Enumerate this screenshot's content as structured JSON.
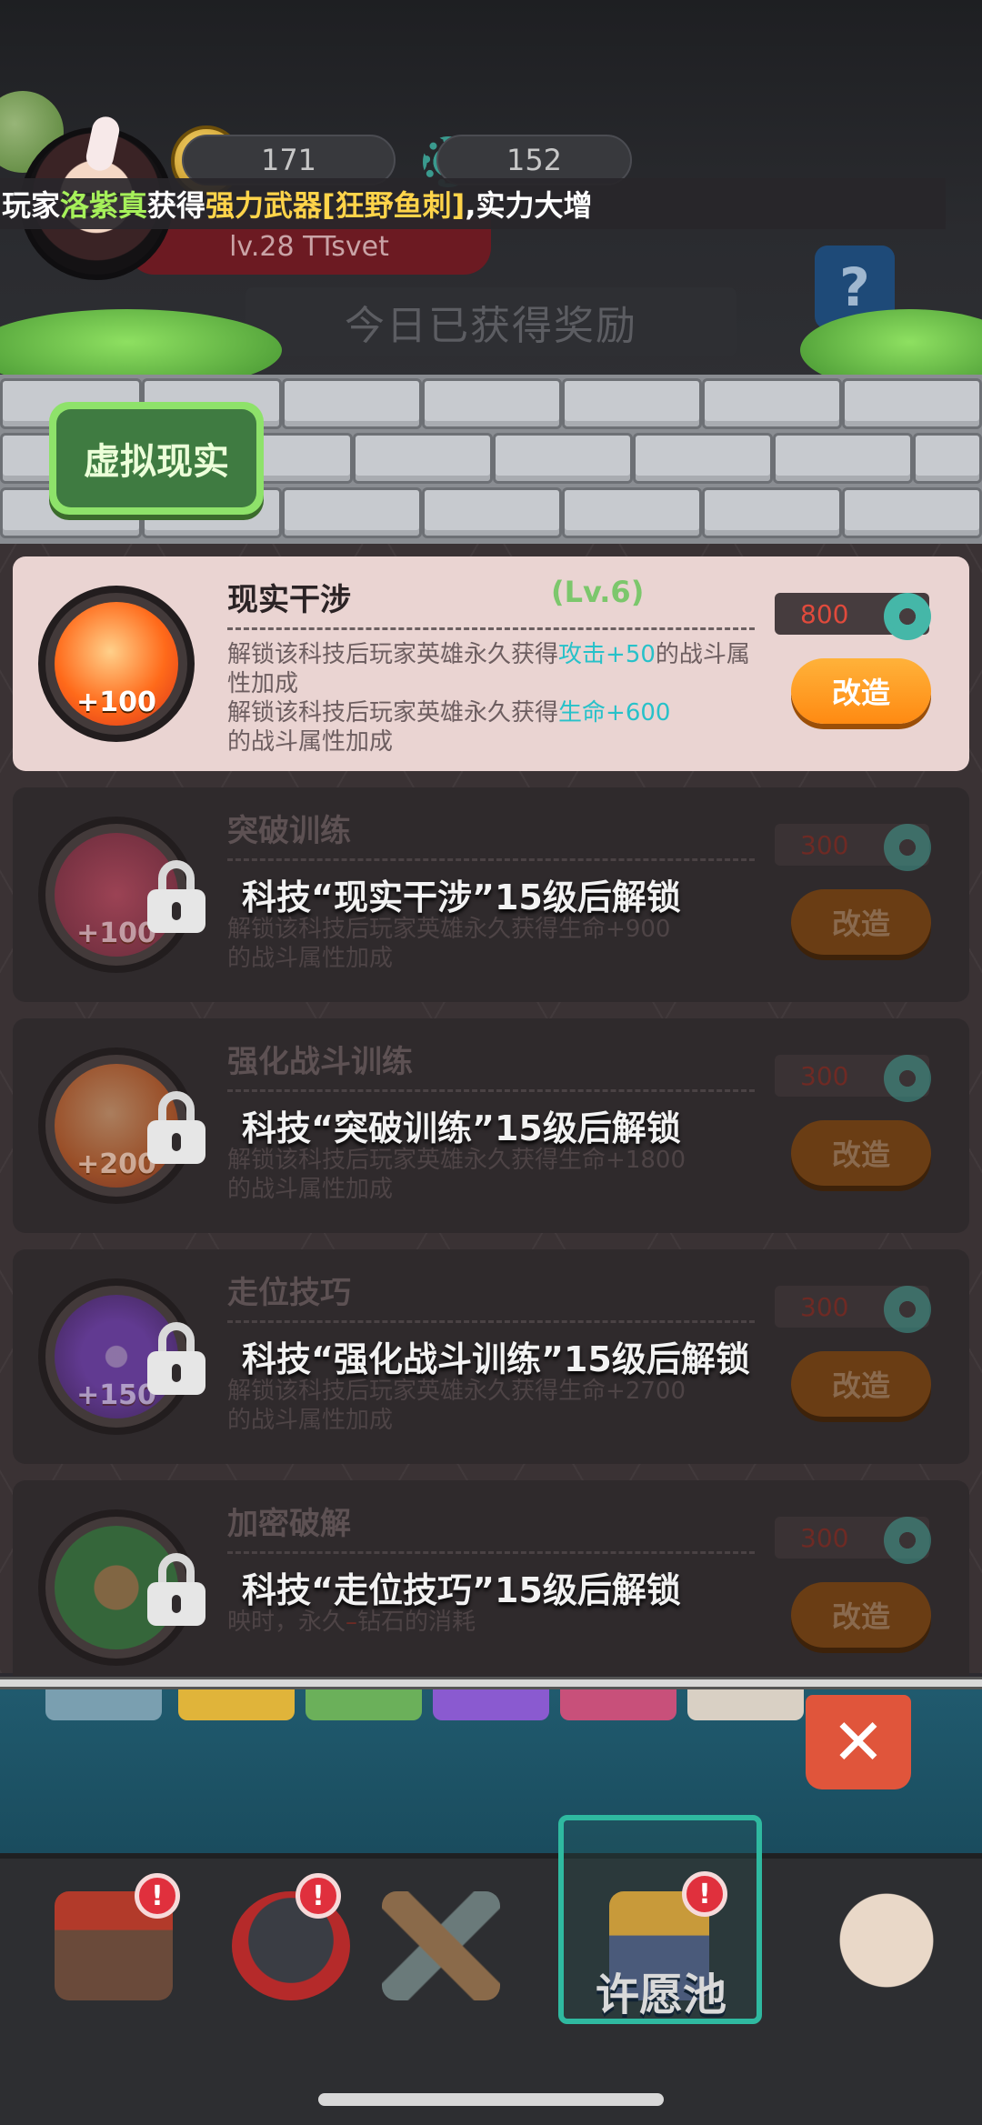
{
  "header": {
    "coins": "171",
    "gears": "152",
    "level": "lv.28",
    "username": "TTsvet",
    "help_symbol": "?",
    "today_label": "今日已获得奖励"
  },
  "ticker": {
    "prefix": "玩家",
    "player": "洛紫真",
    "gained": "获得",
    "item": "强力武器[狂野鱼刺]",
    "suffix": ",实力大增"
  },
  "wall_tab": "虚拟现实",
  "techs": [
    {
      "name": "现实干涉",
      "level": "(Lv.6)",
      "bonus": "+100",
      "desc1_a": "解锁该科技后玩家英雄永久获得",
      "desc1_stat": "攻击",
      "desc1_val": "+50",
      "desc1_b": "的战斗属性加成",
      "desc2_a": "解锁该科技后玩家英雄永久获得",
      "desc2_stat": "生命",
      "desc2_val": "+600",
      "desc2_b": "的战斗属性加成",
      "cost": "800",
      "button": "改造"
    },
    {
      "name": "突破训练",
      "bonus": "+100",
      "lock_text": "科技“现实干涉”15级后解锁",
      "desc_a": "解锁该科技后玩家英雄永久获得",
      "desc_b": "的战斗属性加成",
      "desc2_stat": "生命",
      "desc2_val": "+900",
      "cost": "300",
      "button": "改造"
    },
    {
      "name": "强化战斗训练",
      "bonus": "+200",
      "lock_text": "科技“突破训练”15级后解锁",
      "desc_a": "解锁该科技后玩家英雄永久获得",
      "desc_b": "的战斗属性加成",
      "desc2_stat": "生命",
      "desc2_val": "+1800",
      "cost": "300",
      "button": "改造"
    },
    {
      "name": "走位技巧",
      "bonus": "+150",
      "lock_text": "科技“强化战斗训练”15级后解锁",
      "desc_a": "解锁该科技后玩家英雄永久获得",
      "desc_b": "的战斗属性加成",
      "desc2_stat": "生命",
      "desc2_val": "+2700",
      "cost": "300",
      "button": "改造"
    },
    {
      "name": "加密破解",
      "lock_text": "科技“走位技巧”15级后解锁",
      "desc_partial": "映时，永久",
      "desc_tail": "钻石的消耗",
      "cost": "300",
      "button": "改造"
    }
  ],
  "bottom": {
    "close_symbol": "✕",
    "wish_label": "许愿池",
    "badge": "!"
  },
  "colors": {
    "accent_orange": "#ff9a1e",
    "stat_cyan": "#27c1c9",
    "level_green": "#7cc76c",
    "cost_red": "#e04a3c"
  }
}
